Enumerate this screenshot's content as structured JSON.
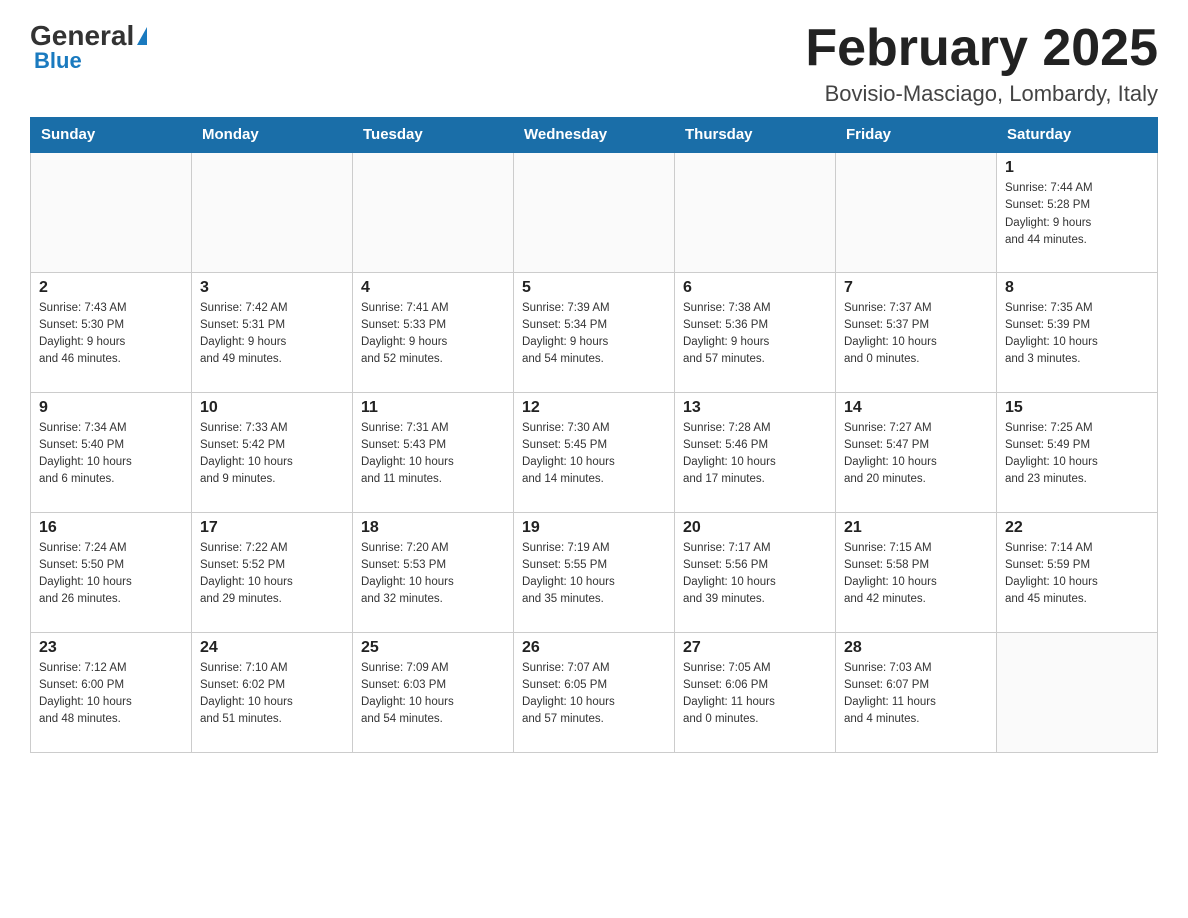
{
  "header": {
    "logo_general": "General",
    "logo_blue": "Blue",
    "month_title": "February 2025",
    "location": "Bovisio-Masciago, Lombardy, Italy"
  },
  "weekdays": [
    "Sunday",
    "Monday",
    "Tuesday",
    "Wednesday",
    "Thursday",
    "Friday",
    "Saturday"
  ],
  "weeks": [
    [
      {
        "day": "",
        "info": ""
      },
      {
        "day": "",
        "info": ""
      },
      {
        "day": "",
        "info": ""
      },
      {
        "day": "",
        "info": ""
      },
      {
        "day": "",
        "info": ""
      },
      {
        "day": "",
        "info": ""
      },
      {
        "day": "1",
        "info": "Sunrise: 7:44 AM\nSunset: 5:28 PM\nDaylight: 9 hours\nand 44 minutes."
      }
    ],
    [
      {
        "day": "2",
        "info": "Sunrise: 7:43 AM\nSunset: 5:30 PM\nDaylight: 9 hours\nand 46 minutes."
      },
      {
        "day": "3",
        "info": "Sunrise: 7:42 AM\nSunset: 5:31 PM\nDaylight: 9 hours\nand 49 minutes."
      },
      {
        "day": "4",
        "info": "Sunrise: 7:41 AM\nSunset: 5:33 PM\nDaylight: 9 hours\nand 52 minutes."
      },
      {
        "day": "5",
        "info": "Sunrise: 7:39 AM\nSunset: 5:34 PM\nDaylight: 9 hours\nand 54 minutes."
      },
      {
        "day": "6",
        "info": "Sunrise: 7:38 AM\nSunset: 5:36 PM\nDaylight: 9 hours\nand 57 minutes."
      },
      {
        "day": "7",
        "info": "Sunrise: 7:37 AM\nSunset: 5:37 PM\nDaylight: 10 hours\nand 0 minutes."
      },
      {
        "day": "8",
        "info": "Sunrise: 7:35 AM\nSunset: 5:39 PM\nDaylight: 10 hours\nand 3 minutes."
      }
    ],
    [
      {
        "day": "9",
        "info": "Sunrise: 7:34 AM\nSunset: 5:40 PM\nDaylight: 10 hours\nand 6 minutes."
      },
      {
        "day": "10",
        "info": "Sunrise: 7:33 AM\nSunset: 5:42 PM\nDaylight: 10 hours\nand 9 minutes."
      },
      {
        "day": "11",
        "info": "Sunrise: 7:31 AM\nSunset: 5:43 PM\nDaylight: 10 hours\nand 11 minutes."
      },
      {
        "day": "12",
        "info": "Sunrise: 7:30 AM\nSunset: 5:45 PM\nDaylight: 10 hours\nand 14 minutes."
      },
      {
        "day": "13",
        "info": "Sunrise: 7:28 AM\nSunset: 5:46 PM\nDaylight: 10 hours\nand 17 minutes."
      },
      {
        "day": "14",
        "info": "Sunrise: 7:27 AM\nSunset: 5:47 PM\nDaylight: 10 hours\nand 20 minutes."
      },
      {
        "day": "15",
        "info": "Sunrise: 7:25 AM\nSunset: 5:49 PM\nDaylight: 10 hours\nand 23 minutes."
      }
    ],
    [
      {
        "day": "16",
        "info": "Sunrise: 7:24 AM\nSunset: 5:50 PM\nDaylight: 10 hours\nand 26 minutes."
      },
      {
        "day": "17",
        "info": "Sunrise: 7:22 AM\nSunset: 5:52 PM\nDaylight: 10 hours\nand 29 minutes."
      },
      {
        "day": "18",
        "info": "Sunrise: 7:20 AM\nSunset: 5:53 PM\nDaylight: 10 hours\nand 32 minutes."
      },
      {
        "day": "19",
        "info": "Sunrise: 7:19 AM\nSunset: 5:55 PM\nDaylight: 10 hours\nand 35 minutes."
      },
      {
        "day": "20",
        "info": "Sunrise: 7:17 AM\nSunset: 5:56 PM\nDaylight: 10 hours\nand 39 minutes."
      },
      {
        "day": "21",
        "info": "Sunrise: 7:15 AM\nSunset: 5:58 PM\nDaylight: 10 hours\nand 42 minutes."
      },
      {
        "day": "22",
        "info": "Sunrise: 7:14 AM\nSunset: 5:59 PM\nDaylight: 10 hours\nand 45 minutes."
      }
    ],
    [
      {
        "day": "23",
        "info": "Sunrise: 7:12 AM\nSunset: 6:00 PM\nDaylight: 10 hours\nand 48 minutes."
      },
      {
        "day": "24",
        "info": "Sunrise: 7:10 AM\nSunset: 6:02 PM\nDaylight: 10 hours\nand 51 minutes."
      },
      {
        "day": "25",
        "info": "Sunrise: 7:09 AM\nSunset: 6:03 PM\nDaylight: 10 hours\nand 54 minutes."
      },
      {
        "day": "26",
        "info": "Sunrise: 7:07 AM\nSunset: 6:05 PM\nDaylight: 10 hours\nand 57 minutes."
      },
      {
        "day": "27",
        "info": "Sunrise: 7:05 AM\nSunset: 6:06 PM\nDaylight: 11 hours\nand 0 minutes."
      },
      {
        "day": "28",
        "info": "Sunrise: 7:03 AM\nSunset: 6:07 PM\nDaylight: 11 hours\nand 4 minutes."
      },
      {
        "day": "",
        "info": ""
      }
    ]
  ]
}
